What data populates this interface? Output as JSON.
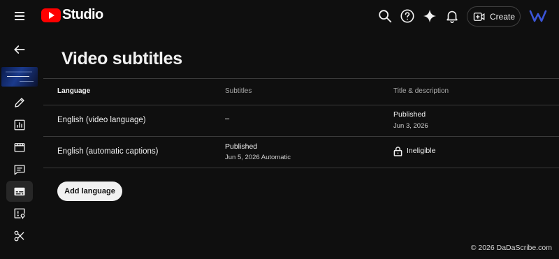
{
  "app": {
    "name": "Studio"
  },
  "header": {
    "create_label": "Create",
    "icons": [
      "search-icon",
      "help-icon",
      "sparkle-icon",
      "bell-icon",
      "create-video-icon"
    ]
  },
  "sidebar": {
    "items": [
      "back-arrow-icon",
      "video-thumbnail",
      "edit-icon",
      "analytics-icon",
      "editor-icon",
      "comments-icon",
      "subtitles-icon",
      "copyright-icon",
      "clips-icon"
    ],
    "active": "subtitles-icon"
  },
  "main": {
    "title": "Video subtitles",
    "columns": {
      "language": "Language",
      "subtitles": "Subtitles",
      "title_desc": "Title & description"
    },
    "rows": [
      {
        "language": "English (video language)",
        "subtitles_status": "–",
        "subtitles_date": "",
        "title_status": "Published",
        "title_date": "Jun 3, 2026"
      },
      {
        "language": "English (automatic captions)",
        "subtitles_status": "Published",
        "subtitles_date": "Jun 5, 2026 Automatic",
        "title_status": "Ineligible",
        "title_date": ""
      }
    ],
    "add_language_label": "Add language"
  },
  "footer": {
    "copyright": "© 2026 DaDaScribe.com"
  },
  "colors": {
    "background": "#0f0f0f",
    "brand_red": "#ff0000",
    "divider": "#3a3a3a",
    "button_bg": "#f1f1f1"
  }
}
